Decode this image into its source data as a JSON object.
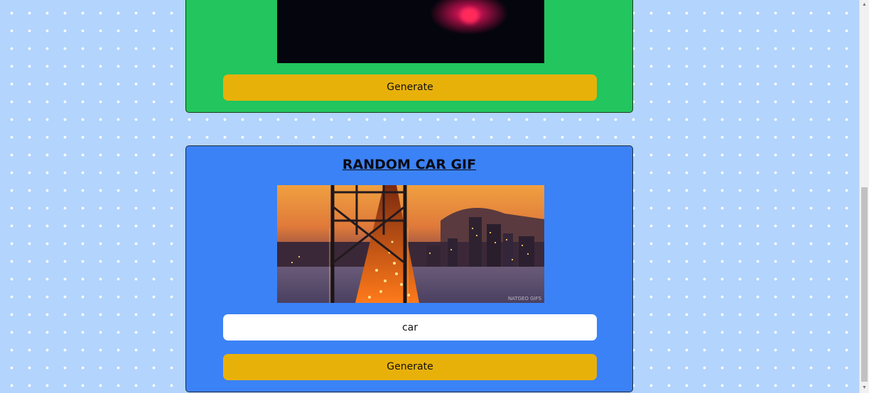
{
  "cards": [
    {
      "gif_alt": "random gif",
      "generate_label": "Generate"
    },
    {
      "title": "RANDOM CAR GIF",
      "gif_alt": "car gif",
      "gif_watermark": "NATGEO GIFS",
      "search": {
        "value": "car"
      },
      "generate_label": "Generate"
    }
  ],
  "colors": {
    "page_background": "#b3d4fc",
    "top_card": "#22c55e",
    "bottom_card": "#3b82f6",
    "button": "#e8b10a"
  },
  "icons": {
    "scroll_up": "scroll-up-arrow-icon",
    "scroll_down": "scroll-down-arrow-icon"
  }
}
